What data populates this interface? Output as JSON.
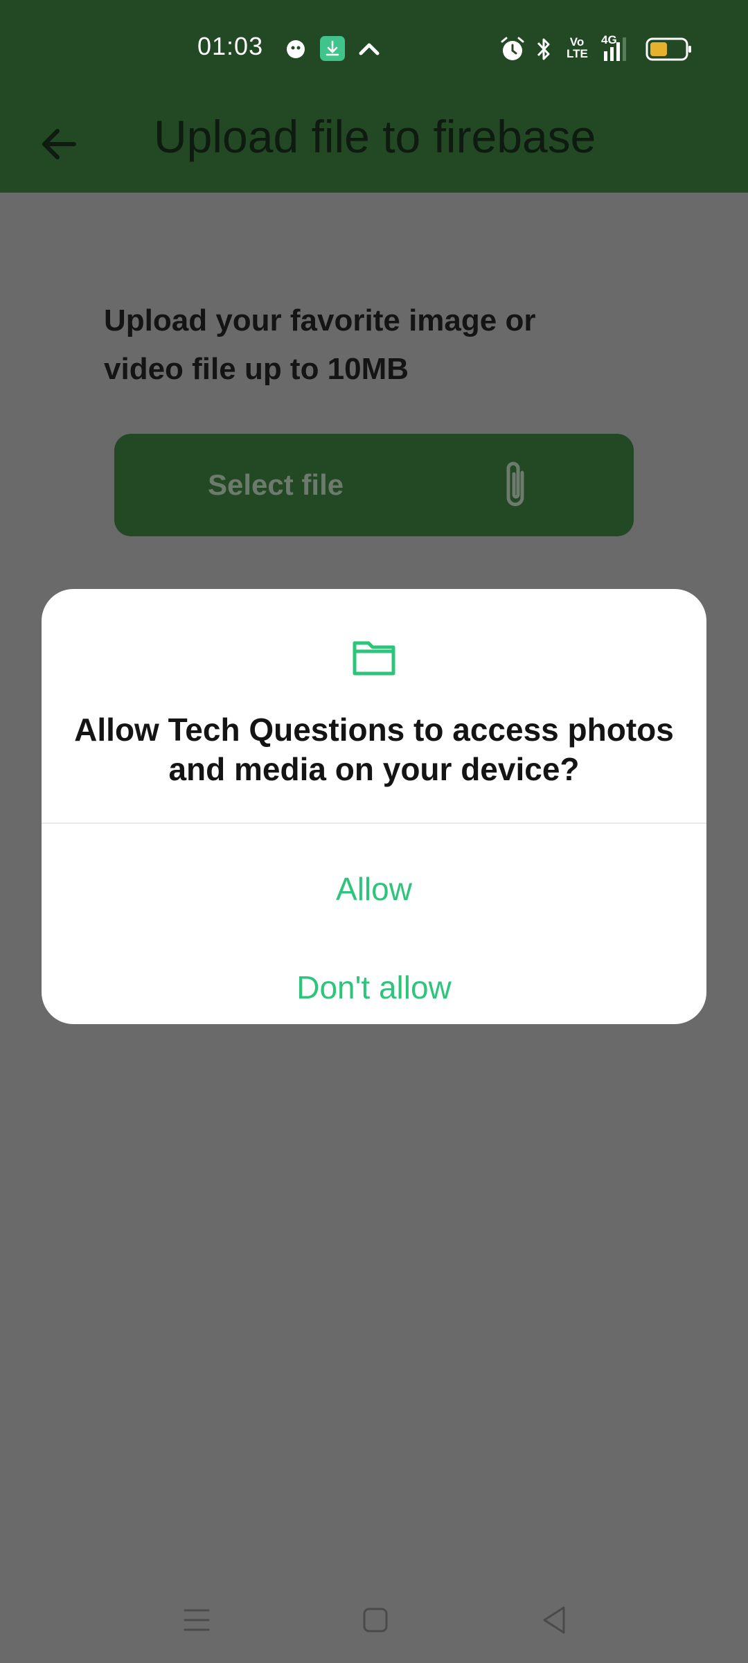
{
  "status_bar": {
    "time": "01:03",
    "icons": [
      "assistant-icon",
      "download-icon",
      "chevron-up-icon",
      "alarm-icon",
      "bluetooth-icon",
      "volte-icon",
      "signal-4g-icon",
      "battery-icon"
    ],
    "network_label": "4G",
    "volte_label_top": "Vo",
    "volte_label_bottom": "LTE"
  },
  "app_bar": {
    "title": "Upload file to firebase",
    "back_icon": "arrow-left-icon"
  },
  "main": {
    "instruction": "Upload your favorite image or video file up to 10MB",
    "select_button_label": "Select file",
    "select_button_icon": "paperclip-icon"
  },
  "dialog": {
    "icon": "folder-icon",
    "message": "Allow Tech Questions to access photos and media on your device?",
    "allow_label": "Allow",
    "deny_label": "Don't allow"
  },
  "nav_bar": {
    "icons": [
      "menu-icon",
      "home-icon",
      "back-triangle-icon"
    ]
  },
  "colors": {
    "primary_dark": "#224824",
    "accent": "#2fc47c",
    "scrim": "#6a6a6a",
    "battery": "#e6b12c"
  }
}
